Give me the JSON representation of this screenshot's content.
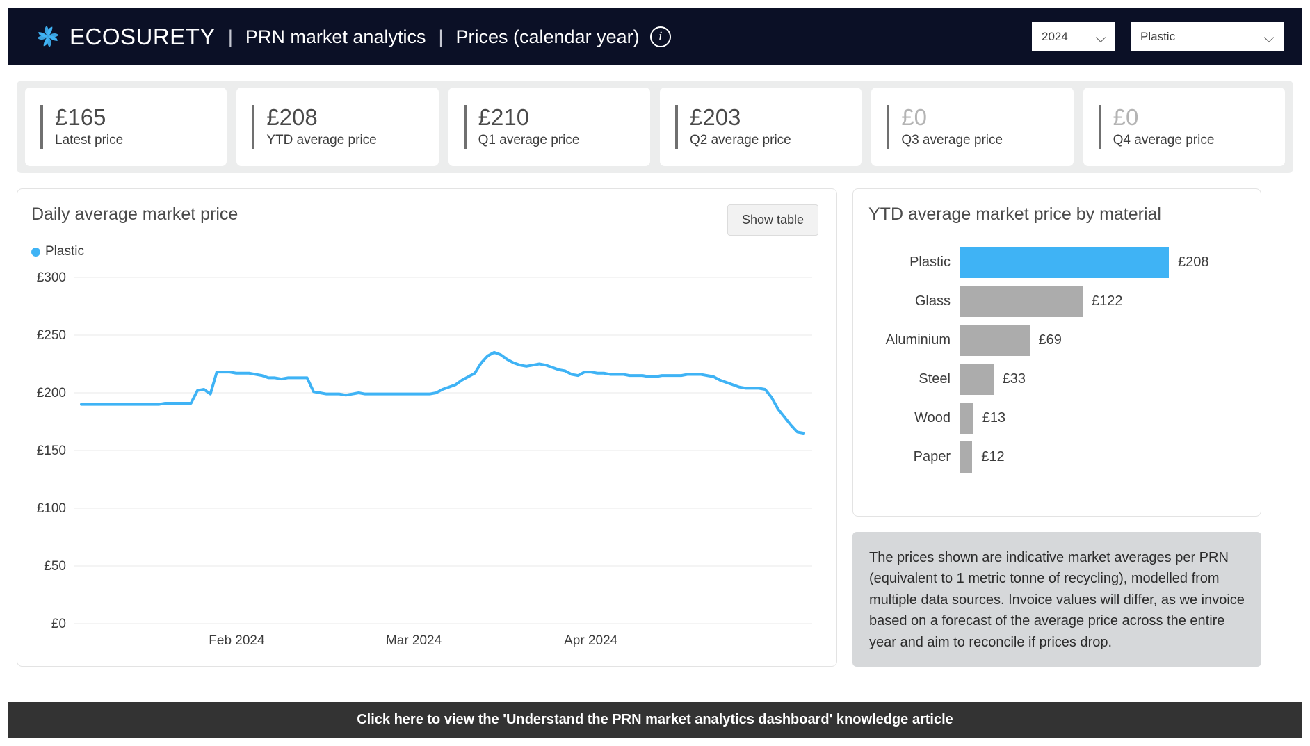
{
  "header": {
    "brand": "ECOSURETY",
    "logo_icon": "ecosurety-pinwheel-logo",
    "separator": "|",
    "section": "PRN market analytics",
    "page_title": "Prices (calendar year)",
    "info_icon": "info-circle-icon",
    "year_select": {
      "value": "2024",
      "chevron_icon": "chevron-down-icon"
    },
    "material_select": {
      "value": "Plastic",
      "chevron_icon": "chevron-down-icon"
    },
    "background_color": "#0b1026"
  },
  "kpis": [
    {
      "value": "£165",
      "label": "Latest price",
      "dim": false
    },
    {
      "value": "£208",
      "label": "YTD average price",
      "dim": false
    },
    {
      "value": "£210",
      "label": "Q1 average price",
      "dim": false
    },
    {
      "value": "£203",
      "label": "Q2 average price",
      "dim": false
    },
    {
      "value": "£0",
      "label": "Q3 average price",
      "dim": true
    },
    {
      "value": "£0",
      "label": "Q4 average price",
      "dim": true
    }
  ],
  "line_panel": {
    "title": "Daily average market price",
    "show_table_label": "Show table",
    "legend_label": "Plastic"
  },
  "bar_panel": {
    "title": "YTD average market price by material"
  },
  "info_box": {
    "text": "The prices shown are indicative market averages per PRN (equivalent to 1 metric tonne of recycling), modelled from multiple data sources. Invoice values will differ, as we invoice based on a forecast of the average price across the entire year and aim to reconcile if prices drop."
  },
  "footer": {
    "label": "Click here to view the 'Understand the PRN market analytics dashboard' knowledge article"
  },
  "colors": {
    "accent": "#3fb3f5",
    "grey_bar": "#acacac",
    "header_bg": "#0b1026",
    "footer_bg": "#333333"
  },
  "chart_data": [
    {
      "type": "line",
      "title": "Daily average market price",
      "xlabel": "",
      "ylabel": "",
      "ylim": [
        0,
        300
      ],
      "yticks": [
        0,
        50,
        100,
        150,
        200,
        250,
        300
      ],
      "ytick_labels": [
        "£0",
        "£50",
        "£100",
        "£150",
        "£200",
        "£250",
        "£300"
      ],
      "xtick_labels": [
        "Feb 2024",
        "Mar 2024",
        "Apr 2024"
      ],
      "xtick_positions": [
        0.22,
        0.46,
        0.7
      ],
      "grid": true,
      "legend": [
        "Plastic"
      ],
      "legend_position": "top-left",
      "series": [
        {
          "name": "Plastic",
          "color": "#3fb3f5",
          "values": [
            190,
            190,
            190,
            190,
            190,
            190,
            190,
            190,
            190,
            190,
            190,
            190,
            190,
            191,
            191,
            191,
            191,
            191,
            202,
            203,
            199,
            218,
            218,
            218,
            217,
            217,
            217,
            216,
            215,
            213,
            213,
            212,
            213,
            213,
            213,
            213,
            201,
            200,
            199,
            199,
            199,
            198,
            199,
            200,
            199,
            199,
            199,
            199,
            199,
            199,
            199,
            199,
            199,
            199,
            199,
            200,
            203,
            205,
            207,
            211,
            214,
            217,
            226,
            232,
            235,
            233,
            229,
            226,
            224,
            223,
            224,
            225,
            224,
            222,
            220,
            219,
            216,
            215,
            218,
            218,
            217,
            217,
            216,
            216,
            216,
            215,
            215,
            215,
            214,
            214,
            215,
            215,
            215,
            215,
            216,
            216,
            216,
            215,
            214,
            211,
            209,
            207,
            205,
            204,
            204,
            204,
            203,
            196,
            186,
            179,
            172,
            166,
            165
          ]
        }
      ]
    },
    {
      "type": "bar",
      "orientation": "horizontal",
      "title": "YTD average market price by material",
      "categories": [
        "Plastic",
        "Glass",
        "Aluminium",
        "Steel",
        "Wood",
        "Paper"
      ],
      "values": [
        208,
        122,
        69,
        33,
        13,
        12
      ],
      "value_labels": [
        "£208",
        "£122",
        "£69",
        "£33",
        "£13",
        "£12"
      ],
      "colors": [
        "#3fb3f5",
        "#acacac",
        "#acacac",
        "#acacac",
        "#acacac",
        "#acacac"
      ],
      "xlim": [
        0,
        208
      ]
    }
  ]
}
